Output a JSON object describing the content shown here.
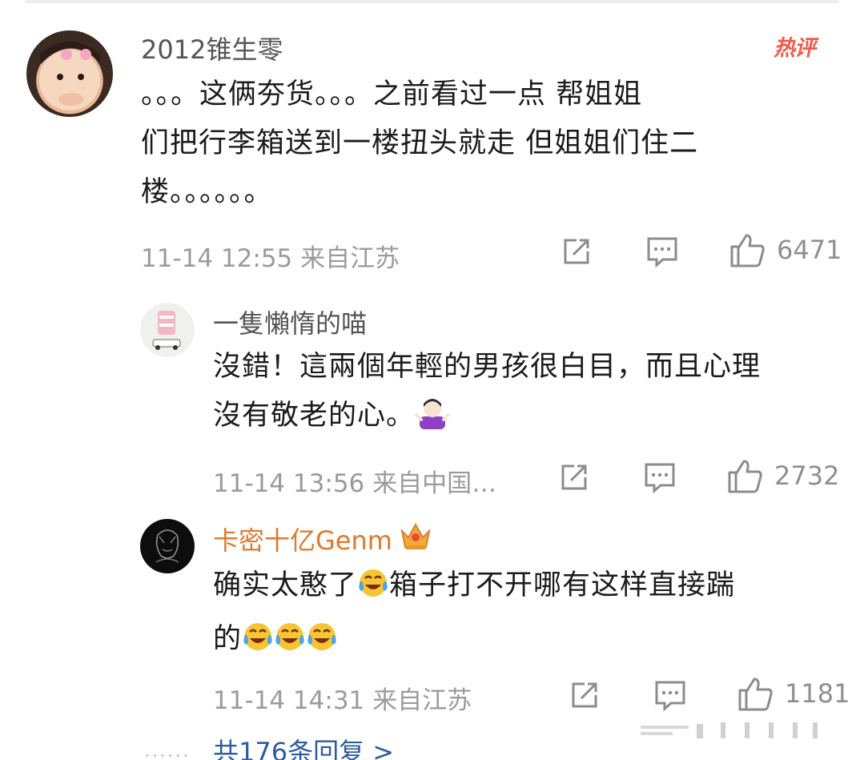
{
  "comments": [
    {
      "username": "2012锥生零",
      "badge": "热评",
      "text_lines": [
        "。。。这俩夯货。。。之前看过一点 帮姐姐",
        "们把行李箱送到一楼扭头就走 但姐姐们住二",
        "楼。。。。。。"
      ],
      "meta": "11-14 12:55 来自江苏",
      "likes": "6471"
    },
    {
      "username": "一隻懶惰的喵",
      "text_line1": "沒錯！這兩個年輕的男孩很白目，而且心理",
      "text_line2": "沒有敬老的心。",
      "meta": "11-14 13:56 来自中国…",
      "likes": "2732"
    },
    {
      "username": "卡密十亿Genm",
      "text_line1a": "确实太憨了",
      "text_line1b": "箱子打不开哪有这样直接踹",
      "text_line2": "的",
      "meta": "11-14 14:31 来自江苏",
      "likes": "1181"
    }
  ],
  "replies_link": "共176条回复 >",
  "colors": {
    "username_gray": "#555555",
    "username_gold": "#e07a2c",
    "hot_badge": "#f35a4a",
    "meta_gray": "#9b9b9b",
    "link_blue": "#2c5aa0"
  },
  "icons": [
    "share-icon",
    "comment-icon",
    "like-icon",
    "crown-icon",
    "laugh-cry-emoji",
    "shrug-emoji"
  ]
}
